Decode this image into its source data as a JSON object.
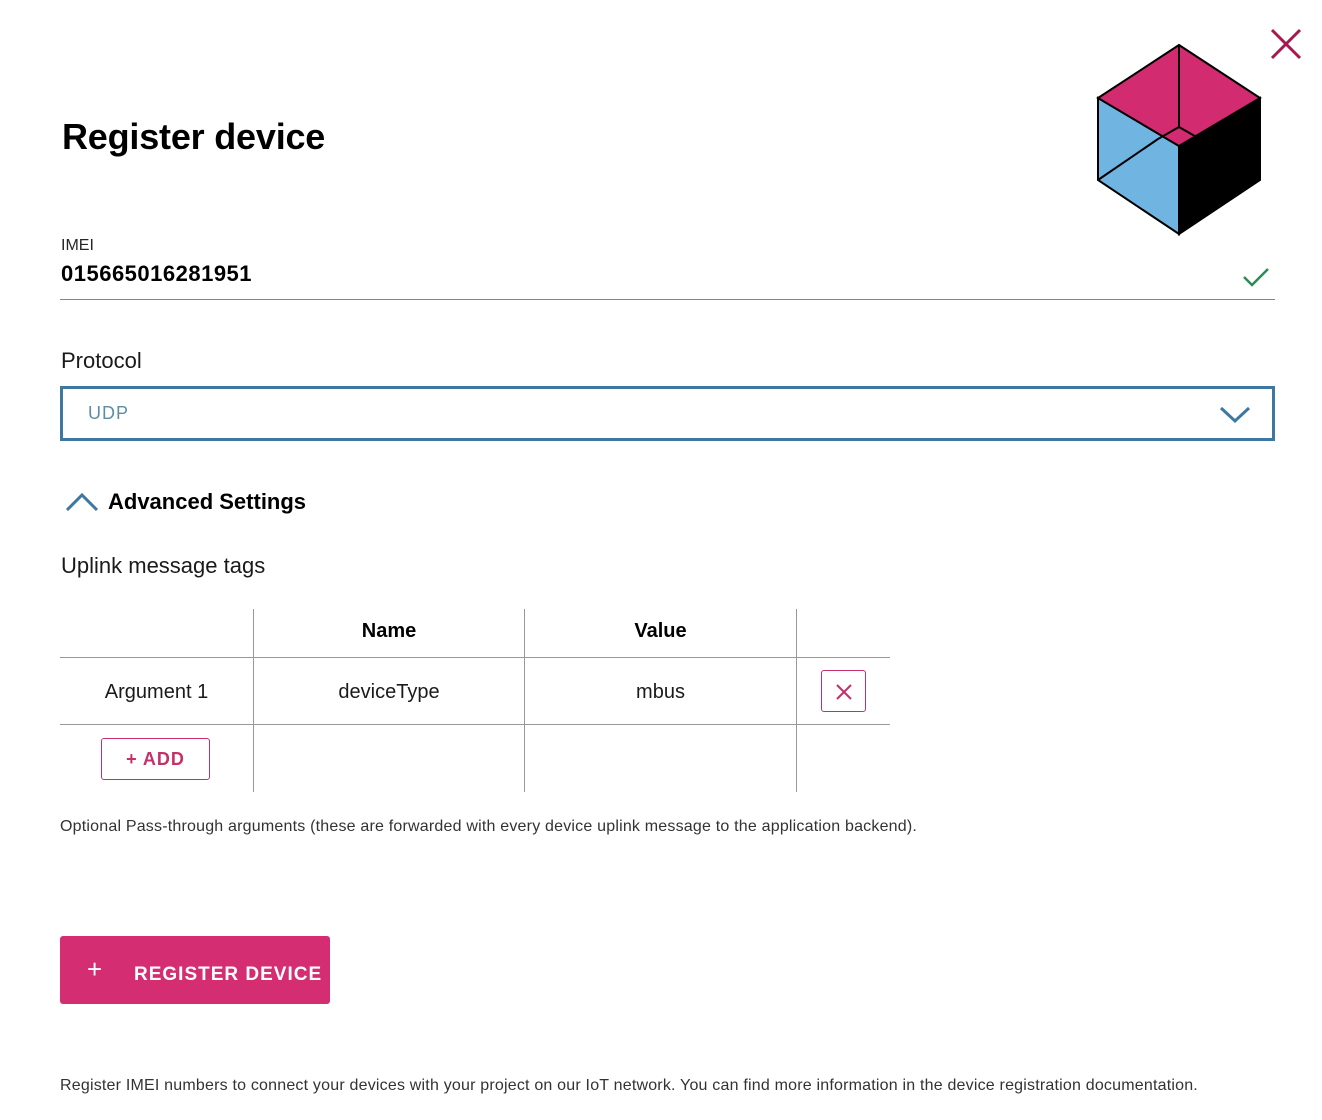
{
  "dialog": {
    "title": "Register device",
    "close_icon": "close-icon",
    "illustration": "cube-illustration"
  },
  "imei": {
    "label": "IMEI",
    "value": "015665016281951",
    "status_icon": "check-icon",
    "valid_color": "#2e8b57"
  },
  "protocol": {
    "label": "Protocol",
    "selected": "UDP",
    "icon": "chevron-down-icon"
  },
  "advanced": {
    "label": "Advanced Settings",
    "icon": "chevron-up-icon",
    "expanded": true
  },
  "uplink": {
    "label": "Uplink message tags",
    "columns": [
      "",
      "Name",
      "Value",
      ""
    ],
    "rows": [
      {
        "argument": "Argument 1",
        "name": "deviceType",
        "value": "mbus",
        "delete_icon": "close-icon"
      }
    ],
    "add_label": "+ ADD",
    "help": "Optional Pass-through arguments (these are forwarded with every device uplink message to the application backend)."
  },
  "register": {
    "plus": "+",
    "label": "REGISTER DEVICE"
  },
  "footer": "Register IMEI numbers to connect your devices with your project on our IoT network. You can find more information in the device registration documentation.",
  "colors": {
    "accent": "#d42d72",
    "select_border": "#3c78a0",
    "cube_magenta": "#d22b70",
    "cube_blue": "#70b4e2",
    "cube_black": "#000000"
  }
}
